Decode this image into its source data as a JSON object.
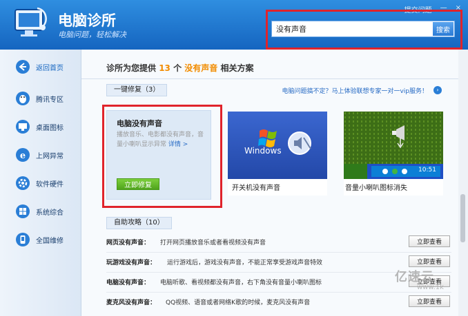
{
  "app": {
    "title": "电脑诊所",
    "slogan": "电脑问题，轻松解决",
    "window_controls": [
      "提交问题",
      "—",
      "×"
    ]
  },
  "search": {
    "value": "没有声音",
    "button_label": "搜索"
  },
  "sidebar": {
    "items": [
      {
        "label": "返回首页",
        "icon": "back-arrow-icon"
      },
      {
        "label": "腾讯专区",
        "icon": "penguin-icon"
      },
      {
        "label": "桌面图标",
        "icon": "desktop-icon"
      },
      {
        "label": "上网异常",
        "icon": "ie-icon"
      },
      {
        "label": "软件硬件",
        "icon": "gear-icon"
      },
      {
        "label": "系统综合",
        "icon": "windows-icon"
      },
      {
        "label": "全国维修",
        "icon": "phone-icon"
      }
    ]
  },
  "result_summary": {
    "prefix": "诊所为您提供",
    "count": "13",
    "unit": "个",
    "keyword": "没有声音",
    "suffix": "相关方案"
  },
  "quick_fix": {
    "section_label": "一键修复（3）",
    "vip_link": "电脑问题搞不定？马上体验联想专家一对一vip服务！",
    "cards": [
      {
        "title": "电脑没有声音",
        "description": "播放音乐、电影都没有声音，音量小喇叭显示异常",
        "more_label": "详情 >",
        "button_label": "立即修复"
      },
      {
        "label": "开关机没有声音",
        "image_text": "Windows"
      },
      {
        "label": "音量小喇叭图标消失",
        "clock": "10:51"
      }
    ]
  },
  "strategies": {
    "section_label": "自助攻略（10）",
    "items": [
      {
        "title": "网页没有声音：",
        "desc": "打开网页播放音乐或者看视频没有声音",
        "button": "立即查看"
      },
      {
        "title": "玩游戏没有声音：",
        "desc": "运行游戏后，游戏没有声音，不能正常享受游戏声音特效",
        "button": "立即查看"
      },
      {
        "title": "电脑没有声音：",
        "desc": "电脑听歌、看视频都没有声音，右下角没有音量小喇叭图标",
        "button": "立即查看"
      },
      {
        "title": "麦克风没有声音：",
        "desc": "QQ视频、语音或者网络K歌的时候，麦克风没有声音",
        "button": "立即查看"
      }
    ]
  },
  "watermark": {
    "cn": "亿速云",
    "en": "www.1k"
  },
  "colors": {
    "accent": "#1565c0",
    "highlight": "#e0232b",
    "keyword": "#f28c00",
    "fix_green": "#4fa41d"
  }
}
